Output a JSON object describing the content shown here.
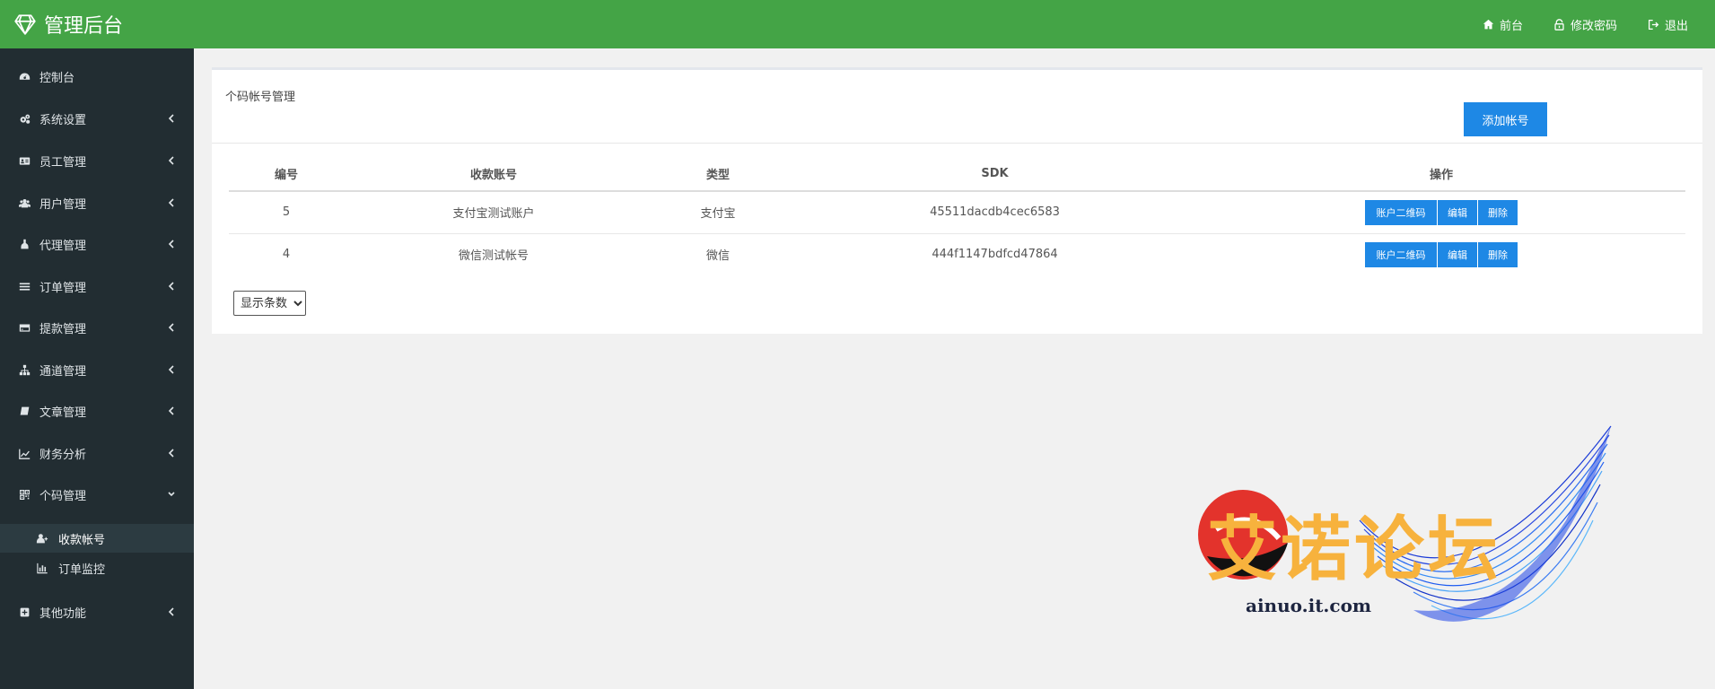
{
  "header": {
    "title": "管理后台",
    "nav": [
      {
        "label": "前台",
        "icon": "home-icon"
      },
      {
        "label": "修改密码",
        "icon": "lock-icon"
      },
      {
        "label": "退出",
        "icon": "sign-out-icon"
      }
    ]
  },
  "sidebar": {
    "items": [
      {
        "label": "控制台",
        "icon": "dashboard-icon"
      },
      {
        "label": "系统设置",
        "icon": "cogs-icon"
      },
      {
        "label": "员工管理",
        "icon": "id-card-icon"
      },
      {
        "label": "用户管理",
        "icon": "users-icon"
      },
      {
        "label": "代理管理",
        "icon": "user-tie-icon"
      },
      {
        "label": "订单管理",
        "icon": "list-icon"
      },
      {
        "label": "提款管理",
        "icon": "credit-card-icon"
      },
      {
        "label": "通道管理",
        "icon": "sitemap-icon"
      },
      {
        "label": "文章管理",
        "icon": "book-icon"
      },
      {
        "label": "财务分析",
        "icon": "line-chart-icon"
      },
      {
        "label": "个码管理",
        "icon": "qrcode-icon"
      },
      {
        "label": "其他功能",
        "icon": "plus-square-icon"
      }
    ],
    "submenu": [
      {
        "label": "收款帐号",
        "icon": "user-plus-icon",
        "active": true
      },
      {
        "label": "订单监控",
        "icon": "bar-chart-icon",
        "active": false
      }
    ]
  },
  "panel": {
    "title": "个码帐号管理",
    "add_button": "添加帐号",
    "columns": [
      "编号",
      "收款账号",
      "类型",
      "SDK",
      "操作"
    ],
    "rows": [
      {
        "id": "5",
        "account": "支付宝测试账户",
        "type": "支付宝",
        "sdk": "45511dacdb4cec6583"
      },
      {
        "id": "4",
        "account": "微信测试帐号",
        "type": "微信",
        "sdk": "444f1147bdfcd47864"
      }
    ],
    "row_actions": {
      "qr": "账户二维码",
      "edit": "编辑",
      "delete": "删除"
    },
    "page_size_label": "显示条数"
  },
  "watermark": {
    "text": "艾诺论坛",
    "url": "ainuo.it.com"
  },
  "colors": {
    "header": "#44a446",
    "sidebar": "#222d32",
    "primary": "#1e88e5"
  }
}
